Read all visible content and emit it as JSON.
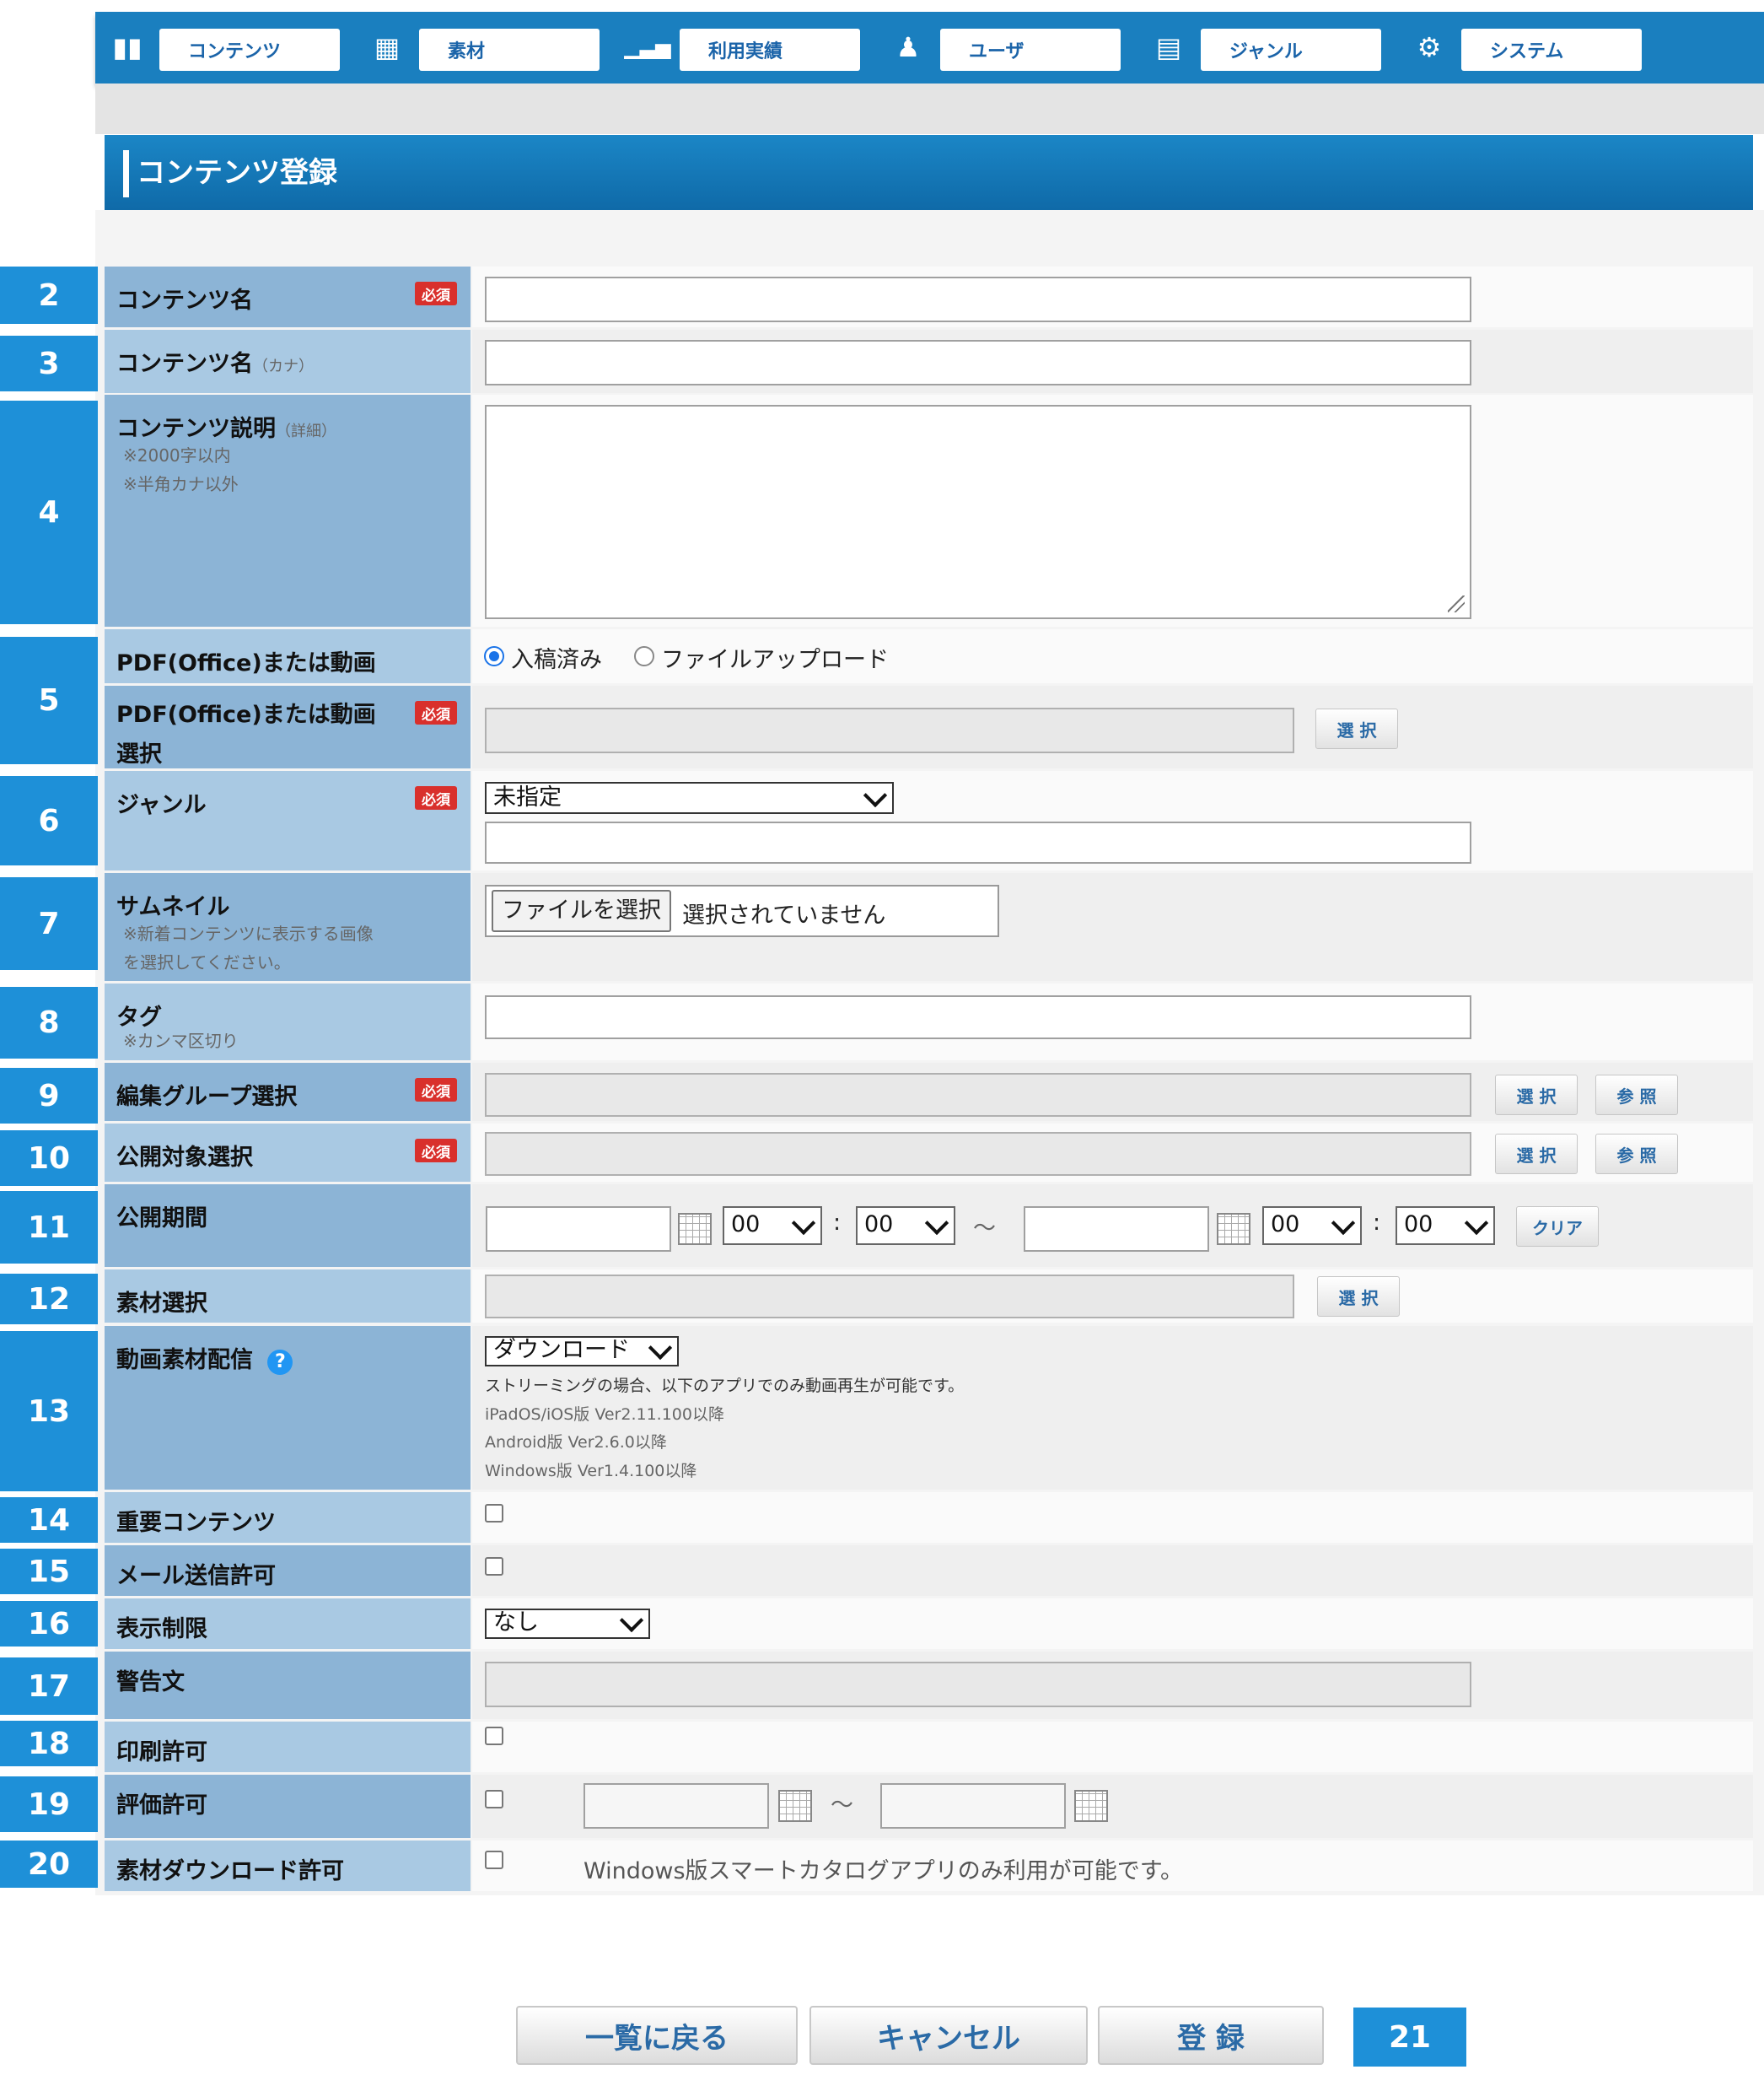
{
  "nav": [
    {
      "label": "コンテンツ",
      "icon": "book-icon"
    },
    {
      "label": "素材",
      "icon": "database-icon"
    },
    {
      "label": "利用実績",
      "icon": "bar-chart-icon"
    },
    {
      "label": "ユーザ",
      "icon": "user-icon"
    },
    {
      "label": "ジャンル",
      "icon": "folder-icon"
    },
    {
      "label": "システム",
      "icon": "gear-icon"
    }
  ],
  "page_title": "コンテンツ登録",
  "required_badge": "必須",
  "labels": {
    "name": "コンテンツ名",
    "name_kana": "コンテンツ名",
    "name_kana_suffix": "（カナ）",
    "description": "コンテンツ説明",
    "description_suffix": "（詳細）",
    "description_note1": "※2000字以内",
    "description_note2": "※半角カナ以外",
    "pdf_video": "PDF(Office)または動画",
    "pdf_video_select_1": "PDF(Office)または動画",
    "pdf_video_select_2": "選択",
    "genre": "ジャンル",
    "thumbnail": "サムネイル",
    "thumbnail_note1": "※新着コンテンツに表示する画像",
    "thumbnail_note2": "を選択してください。",
    "tag": "タグ",
    "tag_note": "※カンマ区切り",
    "edit_group": "編集グループ選択",
    "publish_target": "公開対象選択",
    "publish_period": "公開期間",
    "material_select": "素材選択",
    "video_delivery": "動画素材配信",
    "important": "重要コンテンツ",
    "mail_permit": "メール送信許可",
    "display_limit": "表示制限",
    "warning_text": "警告文",
    "print_permit": "印刷許可",
    "rating_permit": "評価許可",
    "material_download": "素材ダウンロード許可"
  },
  "radio_options": [
    "入稿済み",
    "ファイルアップロード"
  ],
  "buttons": {
    "select": "選 択",
    "refer": "参 照",
    "clear": "クリア",
    "choose_file": "ファイルを選択",
    "back": "一覧に戻る",
    "cancel": "キャンセル",
    "register": "登 録"
  },
  "no_file": "選択されていません",
  "genre_value": "未指定",
  "time": {
    "h1": "00",
    "m1": "00",
    "h2": "00",
    "m2": "00",
    "colon": ":",
    "tilde": "～"
  },
  "video_delivery": {
    "value": "ダウンロード",
    "note": "ストリーミングの場合、以下のアプリでのみ動画再生が可能です。",
    "ios": "iPadOS/iOS版 Ver2.11.100以降",
    "android": "Android版  Ver2.6.0以降",
    "windows": "Windows版  Ver1.4.100以降"
  },
  "help_mark": "?",
  "display_limit_value": "なし",
  "download_note": "Windows版スマートカタログアプリのみ利用が可能です。",
  "markers": [
    "2",
    "3",
    "4",
    "5",
    "6",
    "7",
    "8",
    "9",
    "10",
    "11",
    "12",
    "13",
    "14",
    "15",
    "16",
    "17",
    "18",
    "19",
    "20",
    "21"
  ]
}
